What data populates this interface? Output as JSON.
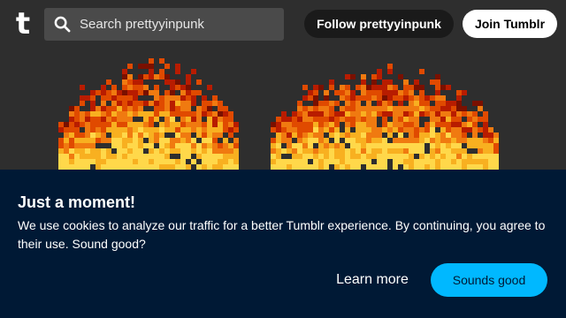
{
  "header": {
    "logo_letter": "t",
    "logo_name": "tumblr-logo",
    "search_placeholder": "Search prettyyinpunk",
    "search_icon": "search-icon",
    "follow_label": "Follow prettyyinpunk",
    "join_label": "Join Tumblr"
  },
  "banner": {
    "image": "pixel-art-fire",
    "flame_colors": [
      "#7a1000",
      "#b81c00",
      "#e04a00",
      "#f07a10",
      "#f8b020",
      "#ffd84a"
    ]
  },
  "cookie": {
    "title": "Just a moment!",
    "text": "We use cookies to analyze our traffic for a better Tumblr experience. By continuing, you agree to their use. Sound good?",
    "learn_more_label": "Learn more",
    "accept_label": "Sounds good"
  },
  "colors": {
    "page_bg": "#2e2e2e",
    "dialog_bg": "#001935",
    "accent": "#00b8ff"
  }
}
